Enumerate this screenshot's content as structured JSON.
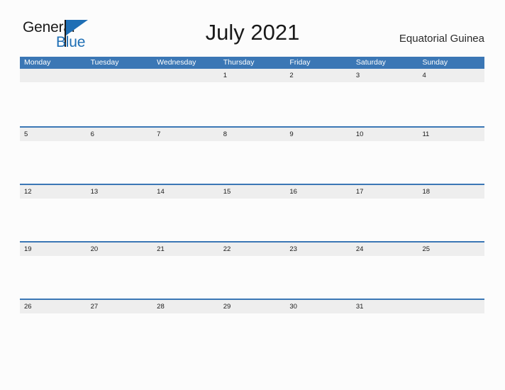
{
  "brand": {
    "name_part1": "General",
    "name_part2": "Blue",
    "primary_color": "#1f6fb5",
    "text_color": "#1a1a1a"
  },
  "header": {
    "title": "July 2021",
    "region": "Equatorial Guinea"
  },
  "calendar": {
    "month": "July",
    "year": "2021",
    "header_bg": "#3b77b5",
    "date_strip_bg": "#eeeeee",
    "separator_color": "#3b77b5",
    "weekdays": [
      "Monday",
      "Tuesday",
      "Wednesday",
      "Thursday",
      "Friday",
      "Saturday",
      "Sunday"
    ],
    "weeks": [
      {
        "days": [
          "",
          "",
          "",
          "1",
          "2",
          "3",
          "4"
        ]
      },
      {
        "days": [
          "5",
          "6",
          "7",
          "8",
          "9",
          "10",
          "11"
        ]
      },
      {
        "days": [
          "12",
          "13",
          "14",
          "15",
          "16",
          "17",
          "18"
        ]
      },
      {
        "days": [
          "19",
          "20",
          "21",
          "22",
          "23",
          "24",
          "25"
        ]
      },
      {
        "days": [
          "26",
          "27",
          "28",
          "29",
          "30",
          "31",
          ""
        ]
      }
    ]
  }
}
